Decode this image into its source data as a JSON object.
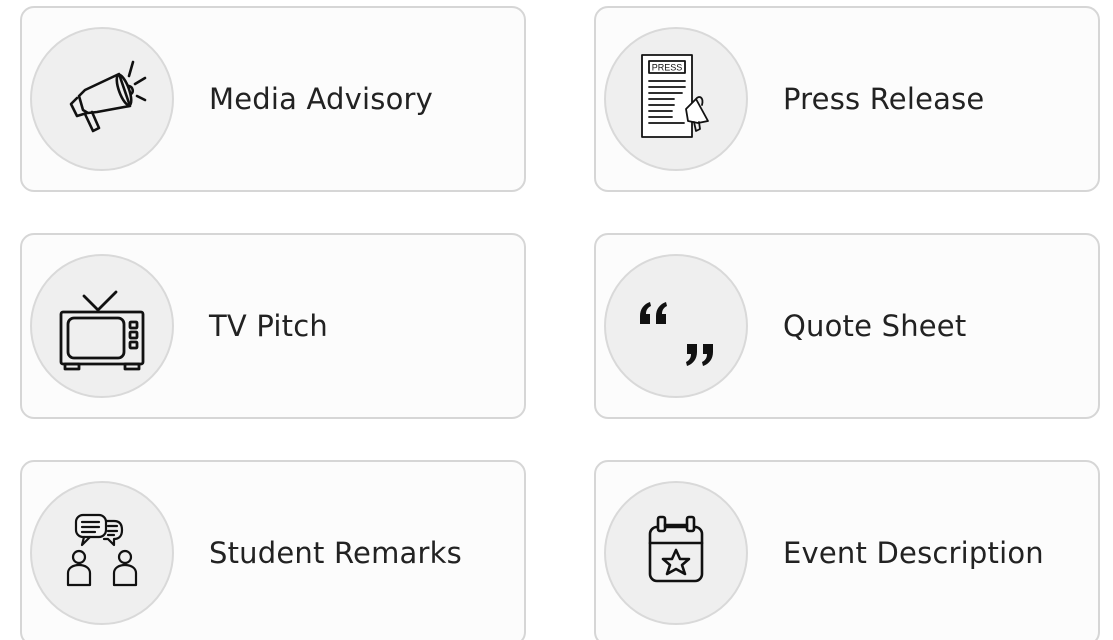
{
  "cards": [
    {
      "label": "Media Advisory",
      "icon": "megaphone-icon"
    },
    {
      "label": "Press Release",
      "icon": "press-release-icon",
      "icon_text": "PRESS"
    },
    {
      "label": "TV Pitch",
      "icon": "television-icon"
    },
    {
      "label": "Quote Sheet",
      "icon": "quote-marks-icon"
    },
    {
      "label": "Student Remarks",
      "icon": "conversation-icon"
    },
    {
      "label": "Event Description",
      "icon": "calendar-star-icon"
    }
  ],
  "colors": {
    "card_border": "#d6d6d6",
    "card_background": "#fcfcfc",
    "icon_circle": "#efefef",
    "text": "#222222"
  }
}
